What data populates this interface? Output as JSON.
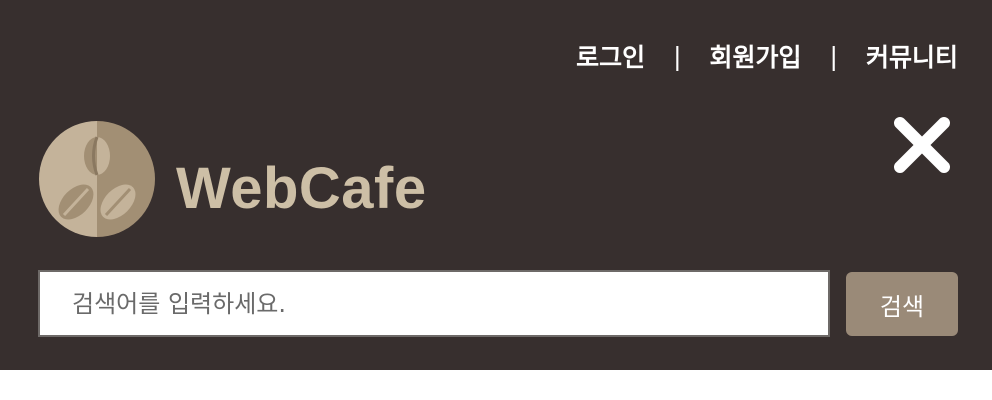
{
  "header": {
    "nav": {
      "login": "로그인",
      "signup": "회원가입",
      "community": "커뮤니티",
      "separator": "|"
    },
    "logo": {
      "text": "WebCafe",
      "icon": "coffee-bean-logo-icon"
    },
    "close_icon": "close-icon"
  },
  "search": {
    "placeholder": "검색어를 입력하세요.",
    "value": "",
    "button_label": "검색"
  },
  "colors": {
    "header_bg": "#372f2e",
    "logo_tan": "#cdbfa6",
    "button_bg": "#9a8a78"
  }
}
